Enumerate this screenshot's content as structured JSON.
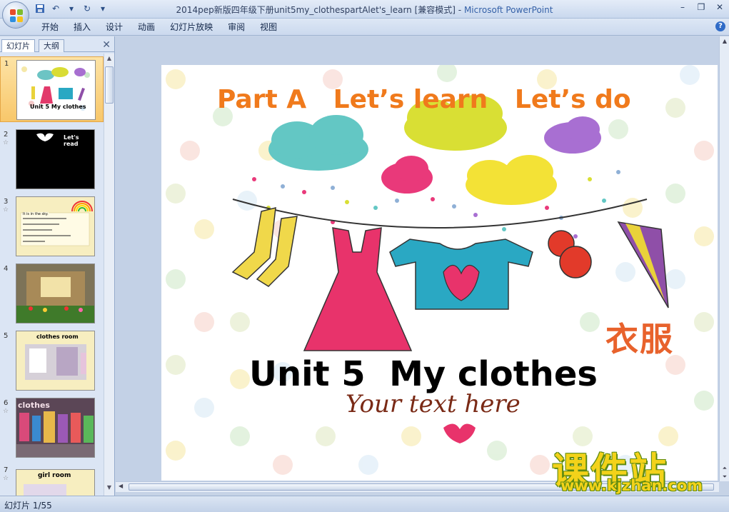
{
  "window": {
    "title": "2014pep新版四年级下册unit5my_clothespartAlet's_learn [兼容模式]",
    "separator": " - ",
    "app_name": "Microsoft PowerPoint"
  },
  "ribbon": {
    "tabs": [
      "开始",
      "插入",
      "设计",
      "动画",
      "幻灯片放映",
      "审阅",
      "视图"
    ]
  },
  "left_pane": {
    "tabs": [
      "幻灯片",
      "大纲"
    ],
    "thumbnails": [
      {
        "number": "1",
        "label": "Unit 5  My clothes"
      },
      {
        "number": "2",
        "label": "Let's read"
      },
      {
        "number": "3",
        "label": "It is in the sky."
      },
      {
        "number": "4",
        "label": ""
      },
      {
        "number": "5",
        "label": "clothes room"
      },
      {
        "number": "6",
        "label": "clothes"
      },
      {
        "number": "7",
        "label": "girl room"
      }
    ]
  },
  "slide": {
    "title": "Part A   Let’s learn   Let’s do",
    "chinese": "衣服",
    "unit": "Unit 5  My clothes",
    "script": "Your text here"
  },
  "watermark": {
    "name": "课件站",
    "url": "www.kjzhan.com"
  },
  "status_bar": {
    "slide_indicator": "幻灯片 1/55"
  },
  "colors": {
    "title_orange": "#f07a1c",
    "chinese_orange": "#e8622c",
    "watermark_yellow": "#f3d21a"
  }
}
